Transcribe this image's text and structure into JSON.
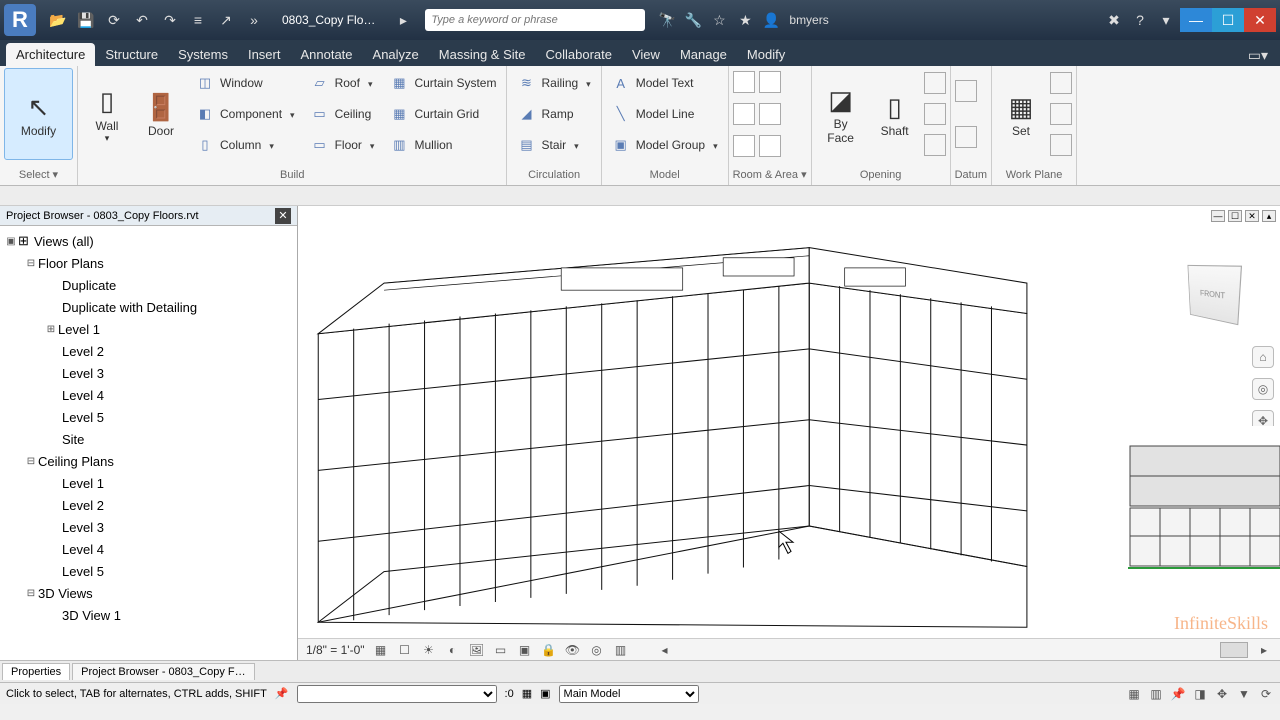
{
  "app": {
    "doc_title": "0803_Copy Flo…",
    "search_placeholder": "Type a keyword or phrase",
    "username": "bmyers"
  },
  "ribbon_tabs": [
    "Architecture",
    "Structure",
    "Systems",
    "Insert",
    "Annotate",
    "Analyze",
    "Massing & Site",
    "Collaborate",
    "View",
    "Manage",
    "Modify"
  ],
  "active_tab": "Architecture",
  "ribbon": {
    "select": {
      "modify": "Modify",
      "panel": "Select ▾"
    },
    "build": {
      "wall": "Wall",
      "door": "Door",
      "row1": {
        "window": "Window",
        "component": "Component",
        "column": "Column"
      },
      "row2": {
        "roof": "Roof",
        "ceiling": "Ceiling",
        "floor": "Floor"
      },
      "row3": {
        "curtain_system": "Curtain  System",
        "curtain_grid": "Curtain  Grid",
        "mullion": "Mullion"
      },
      "panel": "Build"
    },
    "circulation": {
      "railing": "Railing",
      "ramp": "Ramp",
      "stair": "Stair",
      "panel": "Circulation"
    },
    "model": {
      "model_text": "Model  Text",
      "model_line": "Model  Line",
      "model_group": "Model  Group",
      "panel": "Model"
    },
    "room_area": {
      "panel": "Room & Area ▾"
    },
    "opening": {
      "by_face": "By\nFace",
      "shaft": "Shaft",
      "panel": "Opening"
    },
    "datum": {
      "panel": "Datum"
    },
    "workplane": {
      "set": "Set",
      "panel": "Work Plane"
    }
  },
  "browser": {
    "title": "Project Browser - 0803_Copy Floors.rvt",
    "root": "Views (all)",
    "floor_plans": "Floor Plans",
    "fp_items": [
      "Duplicate",
      "Duplicate with Detailing",
      "Level 1",
      "Level 2",
      "Level 3",
      "Level 4",
      "Level 5",
      "Site"
    ],
    "ceiling_plans": "Ceiling Plans",
    "cp_items": [
      "Level 1",
      "Level 2",
      "Level 3",
      "Level 4",
      "Level 5"
    ],
    "three_d": "3D Views",
    "td_items": [
      "3D View 1"
    ]
  },
  "bottom_tabs": {
    "properties": "Properties",
    "project_browser": "Project Browser - 0803_Copy F…"
  },
  "view_status": {
    "scale": "1/8\" = 1'-0\"",
    "crumb": ""
  },
  "statusbar": {
    "hint": "Click to select, TAB for alternates, CTRL adds, SHIFT",
    "zero": ":0",
    "main_model": "Main Model"
  },
  "viewcube": "FRONT",
  "watermark": "InfiniteSkills"
}
